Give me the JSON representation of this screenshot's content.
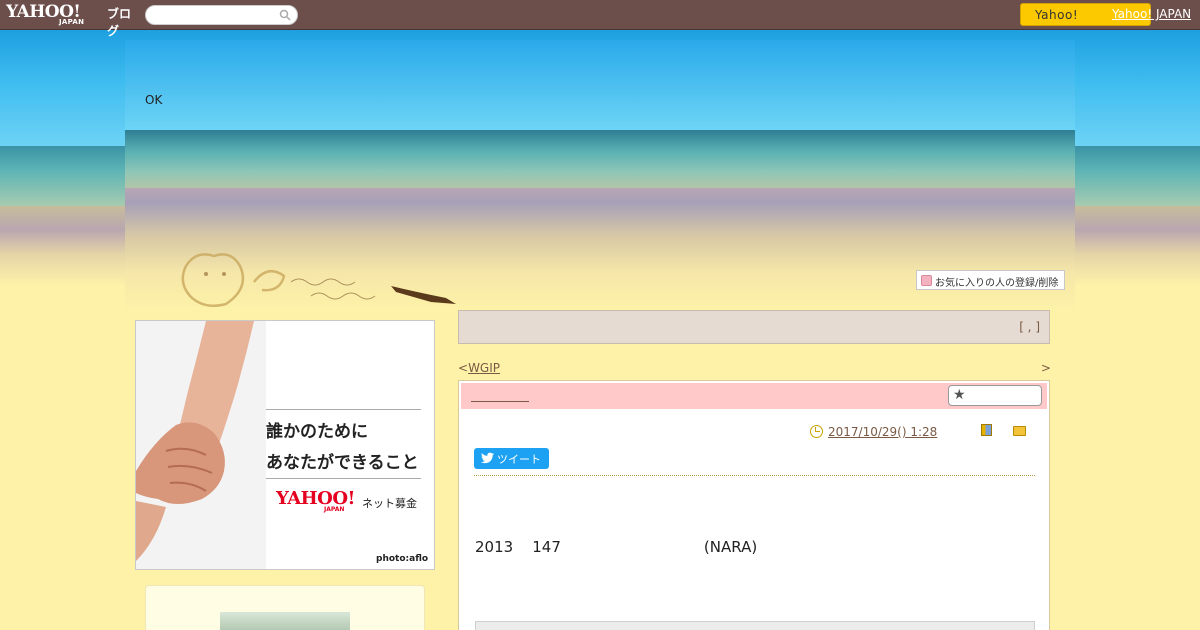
{
  "topbar": {
    "logo_yahoo": "YAHOO!",
    "logo_japan": "JAPAN",
    "logo_blog": "ブログ",
    "search_placeholder": "",
    "yahoo_button": "Yahoo!",
    "yahoo_link": "Yahoo! JAPAN"
  },
  "header": {
    "blog_title": "OK",
    "favorite_button": "お気に入りの人の登録/削除"
  },
  "sidebar": {
    "ad": {
      "line1": "誰かのために",
      "line2": "あなたができること",
      "brand": "YAHOO!",
      "brand_sub": "JAPAN",
      "service": "ネット募金",
      "credit": "photo:aflo"
    }
  },
  "main": {
    "topbox_text": "[ , ]",
    "nav_prev_arrow": "<",
    "nav_prev_label": "WGIP",
    "nav_next_arrow": ">",
    "nav_next_label": "",
    "article": {
      "date": "2017/10/29()  1:28",
      "tweet_label": "ツイート",
      "body": "2013    147                              (NARA)"
    }
  },
  "colors": {
    "topbar": "#6c4f4b",
    "yahoo_button": "#fcc800",
    "article_head": "#ffc9c9",
    "tweet": "#1da1f2",
    "link": "#7a5a44"
  }
}
